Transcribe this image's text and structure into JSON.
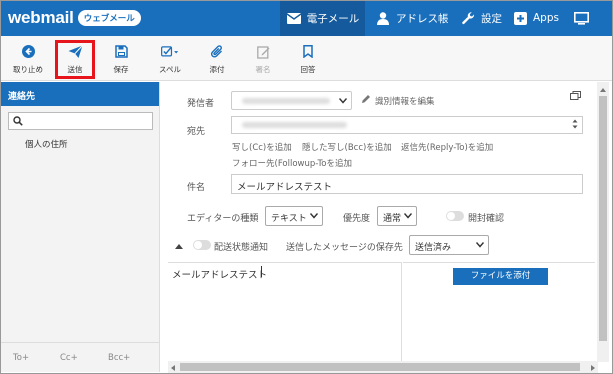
{
  "app": {
    "logo": "webmail",
    "badge": "ウェブメール"
  },
  "nav": {
    "mail": "電子メール",
    "addressbook": "アドレス帳",
    "settings": "設定",
    "apps": "Apps"
  },
  "toolbar": {
    "cancel": "取り止め",
    "send": "送信",
    "save": "保存",
    "spell": "スペル",
    "attach": "添付",
    "signature": "署名",
    "reply": "回答"
  },
  "sidebar": {
    "header": "連絡先",
    "item": "個人の住所",
    "to": "To+",
    "cc": "Cc+",
    "bcc": "Bcc+"
  },
  "form": {
    "from_label": "発信者",
    "edit_identity": "識別情報を編集",
    "to_label": "宛先",
    "add_cc": "写し(Cc)を追加",
    "add_bcc": "隠した写し(Bcc)を追加",
    "add_reply_to": "返信先(Reply-To)を追加",
    "add_followup": "フォロー先(Followup-Toを追加",
    "subject_label": "件名",
    "subject_value": "メールアドレステスト",
    "editor_label": "エディターの種類",
    "editor_value": "テキスト",
    "priority_label": "優先度",
    "priority_value": "通常",
    "read_receipt": "開封確認",
    "delivery_status": "配送状態通知",
    "save_sent_label": "送信したメッセージの保存先",
    "save_sent_value": "送信済み",
    "body_text": "メールアドレステスト",
    "attach_file": "ファイルを添付"
  },
  "colors": {
    "brand": "#1a6fbd",
    "highlight": "#e8141c"
  }
}
